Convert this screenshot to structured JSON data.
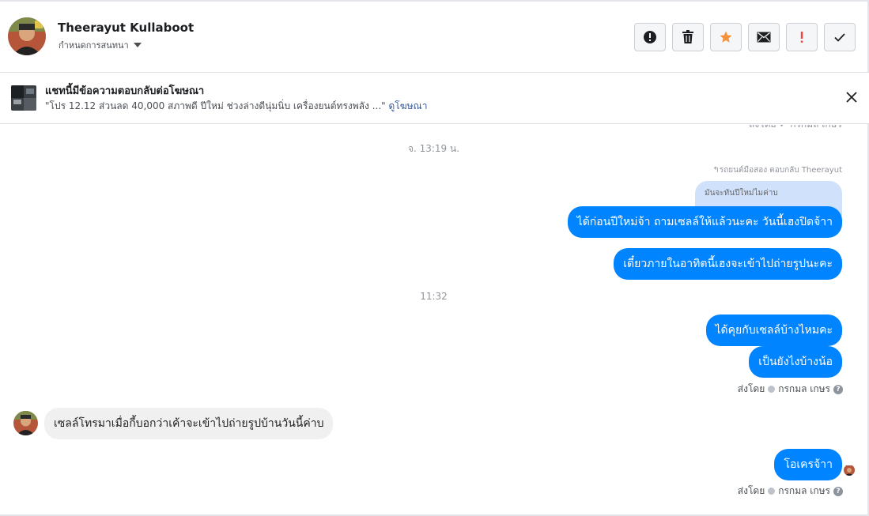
{
  "header": {
    "contact_name": "Theerayut Kullaboot",
    "conversation_settings": "กำหนดการสนทนา",
    "actions": [
      {
        "name": "mark-spam",
        "icon": "alert-circle-icon"
      },
      {
        "name": "delete",
        "icon": "trash-icon"
      },
      {
        "name": "star",
        "icon": "star-icon",
        "color": "#f7923b"
      },
      {
        "name": "mark-unread",
        "icon": "envelope-icon"
      },
      {
        "name": "follow-up",
        "icon": "exclamation-icon",
        "color": "#fa3e3e"
      },
      {
        "name": "mark-done",
        "icon": "check-icon"
      }
    ]
  },
  "ad_banner": {
    "title": "แชทนี้มีข้อความตอบกลับต่อโฆษณา",
    "description": "\"โปร 12.12 ส่วนลด 40,000 สภาพดี ปีใหม่ ช่วงล่างดีนุ่มนิ่บ เครื่องยนต์ทรงพลัง ...\"",
    "link": "ดูโฆษณา"
  },
  "chat": {
    "cut_off_text": "ส่งโดย  ✓ กรกมล เกษร",
    "time_1": "จ. 13:19 น.",
    "reply_label": "↰รถยนต์มือสอง ตอบกลับ Theerayut",
    "quoted_message": "มันจะทันปีใหม่ไมค่าบ",
    "outgoing_1": "ได้ก่อนปีใหม่จ้า ถามเซลล์ให้แล้วนะคะ วันนี้เฮงปิดจ้าา",
    "outgoing_2": "เดี๋ยวภายในอาทิตนี้เฮงจะเข้าไปถ่ายรูปนะคะ",
    "time_2": "11:32",
    "outgoing_3": "ได้คุยกับเซลล์บ้างไหมคะ",
    "outgoing_4": "เป็นยังไงบ้างน้อ",
    "sent_by_1": "ส่งโดย",
    "sender_1": "กรกมล เกษร",
    "incoming_1": "เซลล์โทรมาเมื่อกี้บอกว่าเค้าจะเข้าไปถ่ายรูปบ้านวันนี้ค่าบ",
    "outgoing_5": "โอเครจ้าา",
    "sent_by_2": "ส่งโดย",
    "sender_2": "กรกมล เกษร",
    "help_glyph": "?"
  },
  "colors": {
    "outgoing_bubble": "#0084ff",
    "incoming_bubble": "#f1f0f0",
    "quoted_bubble": "#cfe1fb",
    "link": "#385898"
  }
}
